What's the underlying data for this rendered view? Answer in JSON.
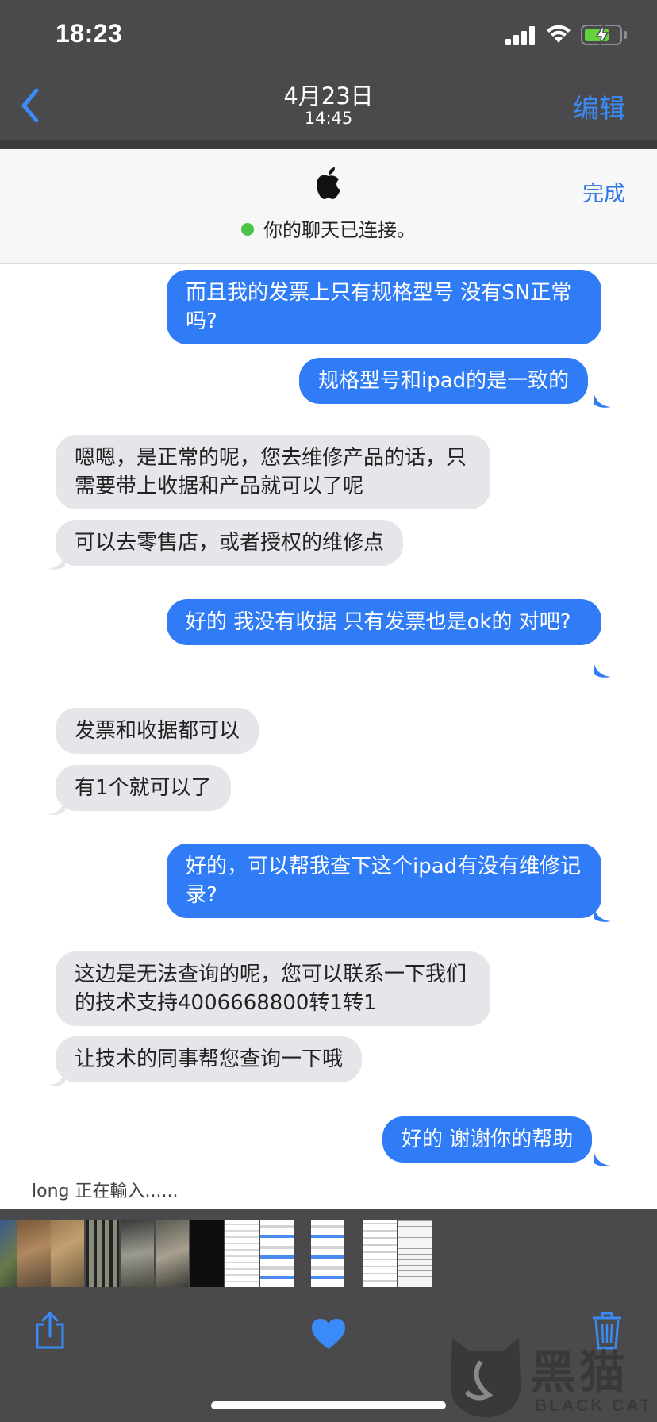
{
  "status_bar": {
    "time": "18:23"
  },
  "nav": {
    "date": "4月23日",
    "time": "14:45",
    "edit_label": "编辑"
  },
  "chat_header": {
    "connection_status": "你的聊天已连接。",
    "done_label": "完成"
  },
  "messages": [
    {
      "direction": "out",
      "text": "而且我的发票上只有规格型号 没有SN正常吗?"
    },
    {
      "direction": "out",
      "text": "规格型号和ipad的是一致的"
    },
    {
      "direction": "in",
      "text": "嗯嗯，是正常的呢，您去维修产品的话，只需要带上收据和产品就可以了呢"
    },
    {
      "direction": "in",
      "text": "可以去零售店，或者授权的维修点"
    },
    {
      "direction": "out",
      "text": "好的 我没有收据 只有发票也是ok的 对吧?"
    },
    {
      "direction": "in",
      "text": "发票和收据都可以"
    },
    {
      "direction": "in",
      "text": "有1个就可以了"
    },
    {
      "direction": "out",
      "text": "好的，可以帮我查下这个ipad有没有维修记录?"
    },
    {
      "direction": "in",
      "text": "这边是无法查询的呢，您可以联系一下我们的技术支持4006668800转1转1"
    },
    {
      "direction": "in",
      "text": "让技术的同事帮您查询一下哦"
    },
    {
      "direction": "out",
      "text": "好的 谢谢你的帮助"
    }
  ],
  "typing_indicator": "long 正在輸入......",
  "toolbar": {
    "share": "share-icon",
    "favorite": "heart-icon",
    "delete": "trash-icon"
  },
  "watermark": {
    "text": "黑猫",
    "sub": "BLACK CAT"
  },
  "colors": {
    "accent": "#3a8bf7",
    "outgoing_bubble": "#2f7cf6",
    "incoming_bubble": "#e5e5ea",
    "online": "#4cc447"
  }
}
